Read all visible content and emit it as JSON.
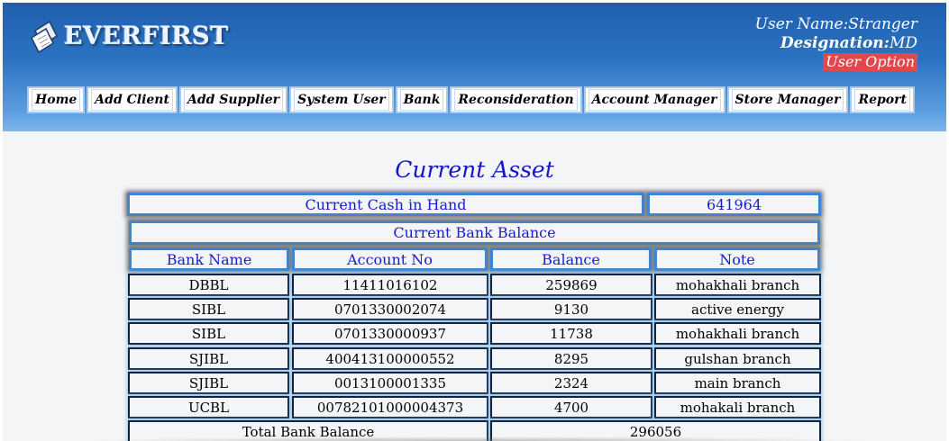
{
  "app": {
    "logo_text": "EVERFIRST"
  },
  "user": {
    "name_label": "User Name:",
    "name_value": "Stranger",
    "designation_label": "Designation:",
    "designation_value": "MD",
    "option_label": "User Option"
  },
  "nav": {
    "items": [
      {
        "label": "Home"
      },
      {
        "label": "Add Client"
      },
      {
        "label": "Add Supplier"
      },
      {
        "label": "System User"
      },
      {
        "label": "Bank"
      },
      {
        "label": "Reconsideration"
      },
      {
        "label": "Account Manager"
      },
      {
        "label": "Store Manager"
      },
      {
        "label": "Report"
      }
    ]
  },
  "page": {
    "title": "Current Asset"
  },
  "cash": {
    "label": "Current Cash in Hand",
    "value": "641964"
  },
  "bank": {
    "section_title": "Current Bank Balance",
    "columns": [
      "Bank Name",
      "Account No",
      "Balance",
      "Note"
    ],
    "rows": [
      [
        "DBBL",
        "11411016102",
        "259869",
        "mohakhali branch"
      ],
      [
        "SIBL",
        "0701330002074",
        "9130",
        "active energy"
      ],
      [
        "SIBL",
        "0701330000937",
        "11738",
        "mohakhali branch"
      ],
      [
        "SJIBL",
        "400413100000552",
        "8295",
        "gulshan branch"
      ],
      [
        "SJIBL",
        "0013100001335",
        "2324",
        "main branch"
      ],
      [
        "UCBL",
        "00782101000004373",
        "4700",
        "mohakali branch"
      ]
    ],
    "total_label": "Total Bank Balance",
    "total_value": "296056"
  },
  "colors": {
    "header_top": "#1f5fae",
    "header_bottom": "#7fb6ec",
    "title_blue": "#1616c9",
    "user_option_bg": "#e0484d"
  }
}
